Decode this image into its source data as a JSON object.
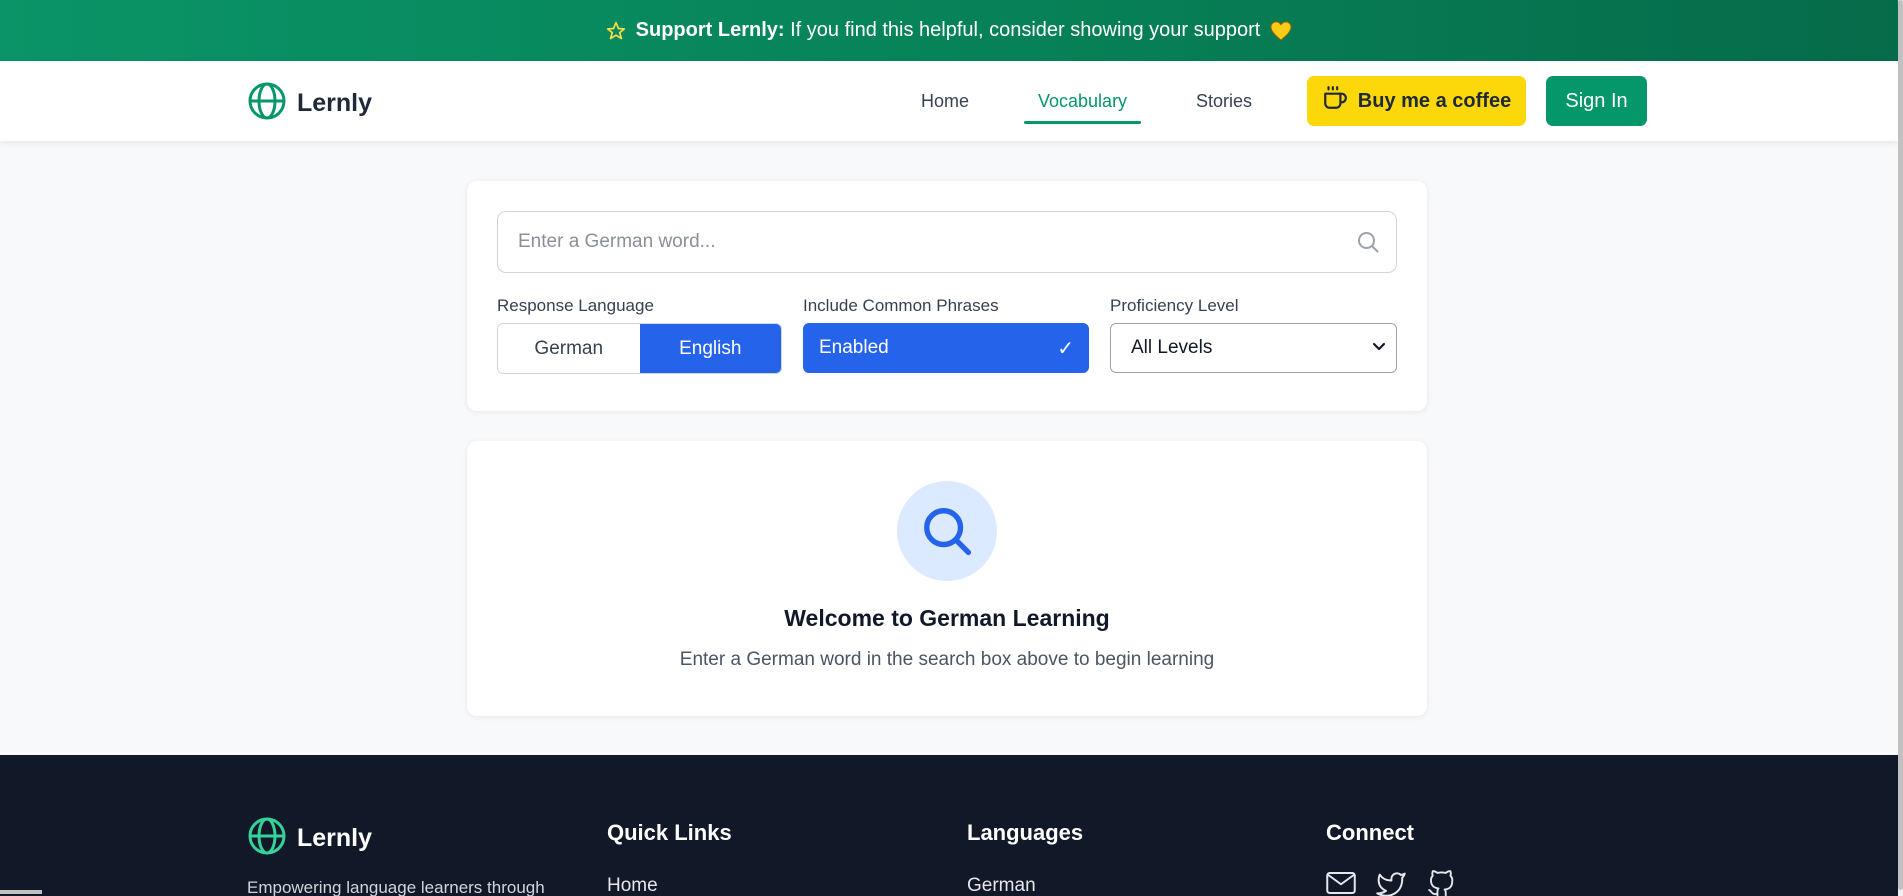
{
  "banner": {
    "bold": "Support Lernly:",
    "text": "If you find this helpful, consider showing your support"
  },
  "header": {
    "brand": "Lernly",
    "nav": [
      {
        "label": "Home",
        "active": false
      },
      {
        "label": "Vocabulary",
        "active": true
      },
      {
        "label": "Stories",
        "active": false
      }
    ],
    "coffee_label": "Buy me a coffee",
    "signin_label": "Sign In"
  },
  "search": {
    "placeholder": "Enter a German word...",
    "value": "",
    "response_language": {
      "label": "Response Language",
      "options": [
        "German",
        "English"
      ],
      "selected": "English"
    },
    "phrases": {
      "label": "Include Common Phrases",
      "value": "Enabled",
      "check": "✓"
    },
    "proficiency": {
      "label": "Proficiency Level",
      "selected": "All Levels"
    }
  },
  "welcome": {
    "title": "Welcome to German Learning",
    "subtitle": "Enter a German word in the search box above to begin learning"
  },
  "footer": {
    "brand": "Lernly",
    "tagline": "Empowering language learners through",
    "quick_links": {
      "heading": "Quick Links",
      "first": "Home"
    },
    "languages": {
      "heading": "Languages",
      "first": "German"
    },
    "connect": {
      "heading": "Connect"
    }
  },
  "colors": {
    "primary_green": "#059669",
    "accent_blue": "#2563eb",
    "coffee_yellow": "#fcd80b",
    "footer_bg": "#111827"
  },
  "icons": {
    "banner_left": "star-icon",
    "banner_right": "heart-icon",
    "logo": "globe-icon",
    "coffee": "coffee-cup-icon",
    "search": "search-icon",
    "social": [
      "mail-icon",
      "twitter-icon",
      "github-icon"
    ]
  }
}
